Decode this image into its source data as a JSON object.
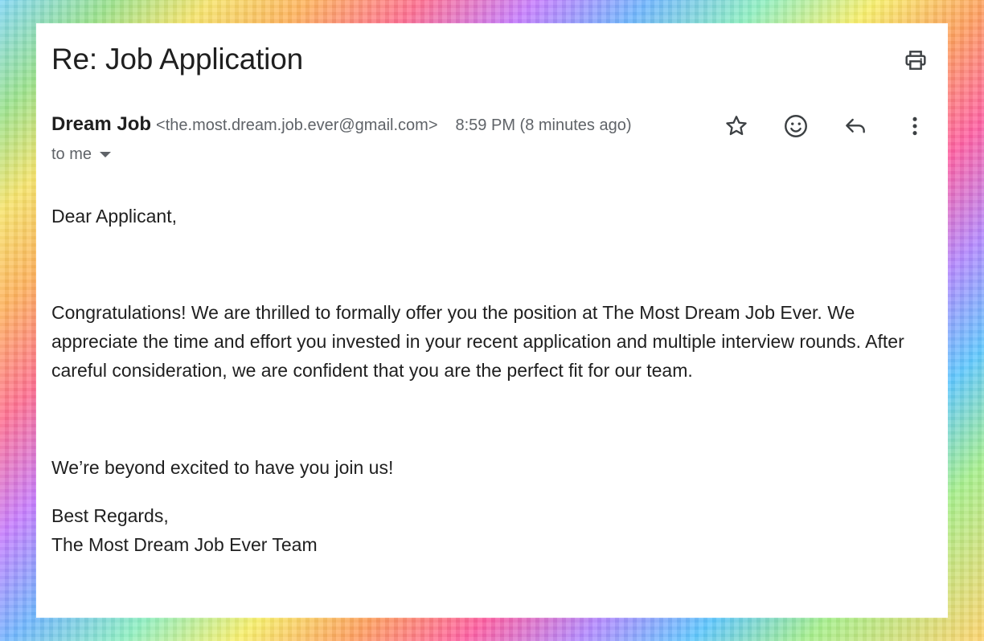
{
  "email": {
    "subject": "Re: Job Application",
    "sender_name": "Dream Job",
    "sender_email": "<the.most.dream.job.ever@gmail.com>",
    "time": "8:59 PM (8 minutes ago)",
    "recipient_label": "to me"
  },
  "icons": {
    "print": "printer-icon",
    "star": "star-icon",
    "emoji": "emoji-reaction-icon",
    "reply": "reply-icon",
    "more": "more-vert-icon",
    "dropdown": "caret-down-icon"
  },
  "body": {
    "greeting": "Dear Applicant,",
    "paragraph": "Congratulations! We are thrilled to formally offer you the position at The Most Dream Job Ever. We appreciate the time and effort you invested in your recent application and multiple interview rounds. After careful consideration, we are confident that you are the perfect fit for our team.",
    "closing_line": "We’re beyond excited to have you join us!",
    "signoff": "Best Regards,",
    "signature": "The Most Dream Job Ever Team"
  },
  "colors": {
    "text_primary": "#1f1f1f",
    "text_secondary": "#5f6368",
    "card_background": "#ffffff"
  }
}
